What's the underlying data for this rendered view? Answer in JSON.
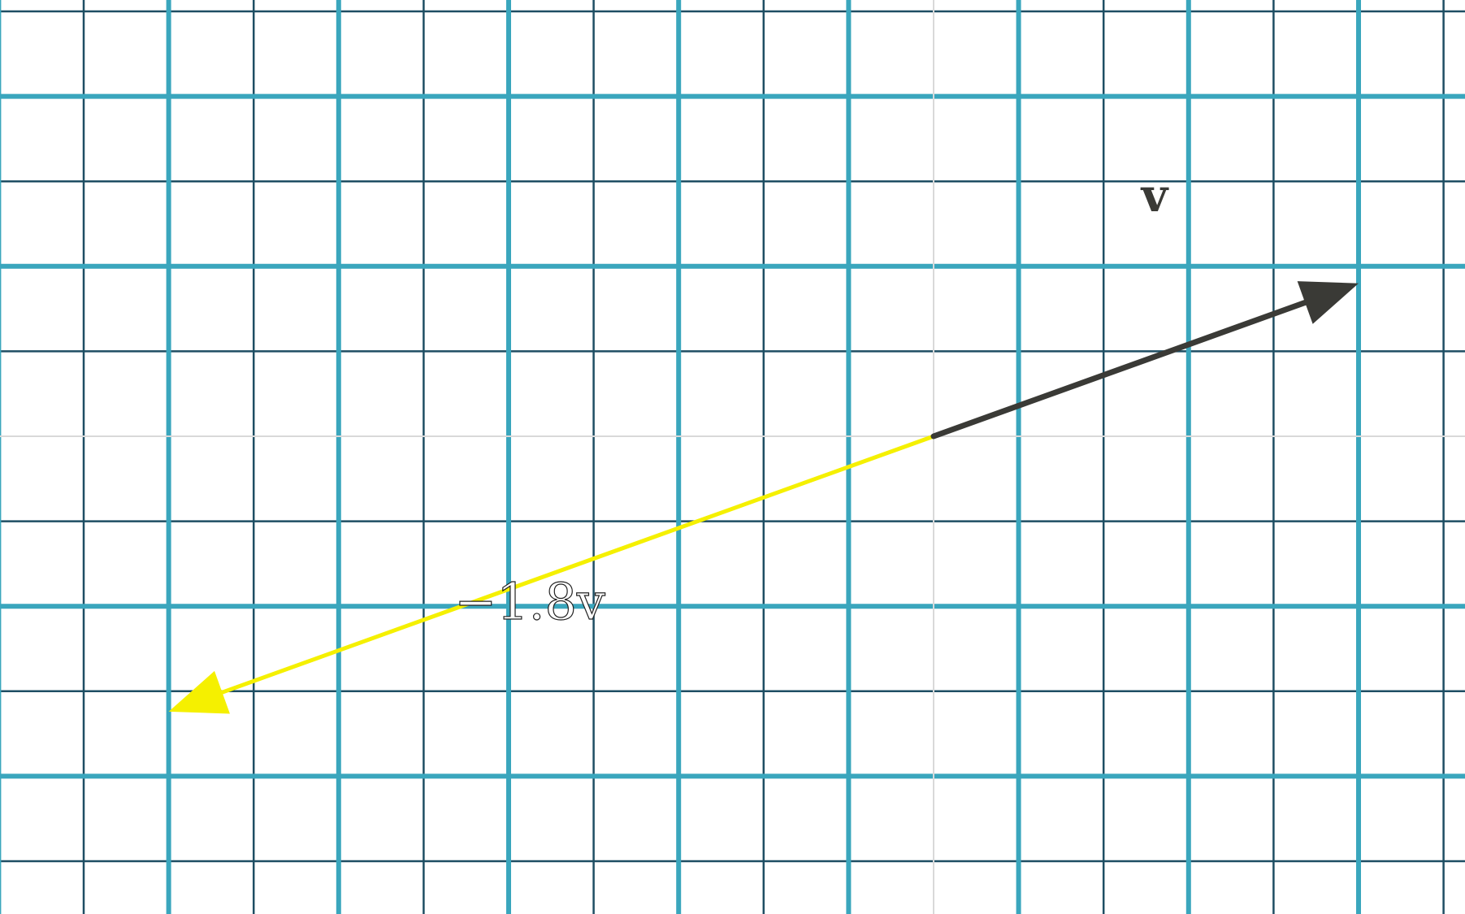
{
  "colors": {
    "background": "#ffffff",
    "grid_major": "#3aa6bd",
    "grid_minor": "#1e4e63",
    "axis": "#d9d9d9",
    "vector_v": "#3a3a36",
    "vector_scaled": "#f5f000"
  },
  "vectors": [
    {
      "id": "v",
      "label": "v",
      "label_prefix": "",
      "components": [
        1,
        0.36
      ],
      "color": "#3a3a36"
    },
    {
      "id": "scaled",
      "label": "v",
      "label_prefix": "−1.8",
      "components": [
        -1.8,
        -0.648
      ],
      "color": "#f5f000"
    }
  ]
}
